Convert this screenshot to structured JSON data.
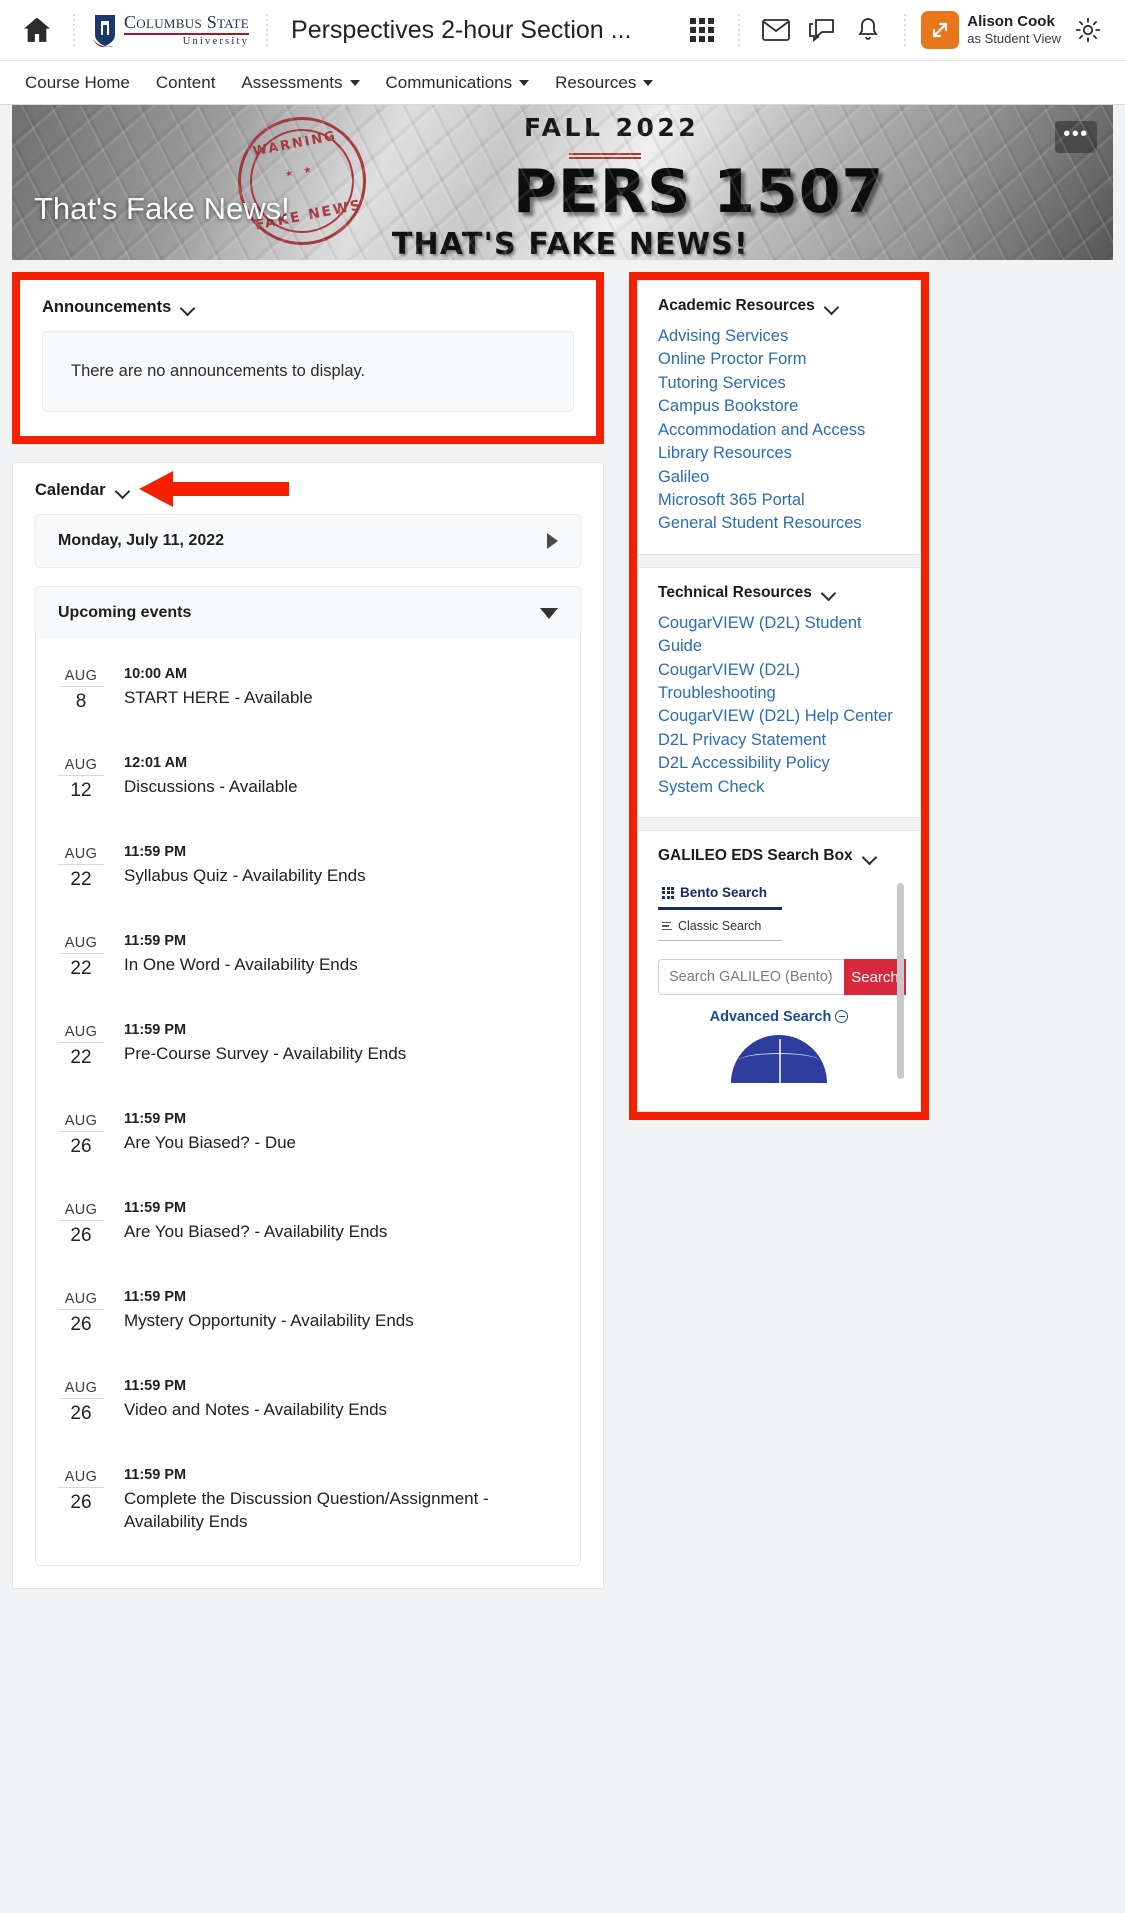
{
  "topbar": {
    "home_label": "Home",
    "logo": {
      "line1": "Columbus State",
      "rule": "",
      "line2": "University"
    },
    "course_title": "Perspectives 2-hour Section ...",
    "waffle_label": "Course Selector",
    "email_label": "Email",
    "messages_label": "Subscription Alerts",
    "notifications_label": "Update Alerts",
    "user": {
      "name": "Alison Cook",
      "role": "as Student View"
    },
    "settings_label": "Settings"
  },
  "coursenav": {
    "items": [
      {
        "label": "Course Home",
        "has_caret": false
      },
      {
        "label": "Content",
        "has_caret": false
      },
      {
        "label": "Assessments",
        "has_caret": true
      },
      {
        "label": "Communications",
        "has_caret": true
      },
      {
        "label": "Resources",
        "has_caret": true
      }
    ]
  },
  "banner": {
    "overlay_title": "That's Fake News!",
    "term": "FALL 2022",
    "course_code": "PERS 1507",
    "tagline": "THAT'S FAKE NEWS!",
    "stamp_top": "WARNING",
    "stamp_bottom": "FAKE NEWS",
    "stamp_stars": "★ ★",
    "more_label": "•••"
  },
  "announcements": {
    "title": "Announcements",
    "empty_message": "There are no announcements to display."
  },
  "calendar": {
    "title": "Calendar",
    "current_date": "Monday, July 11, 2022",
    "upcoming_label": "Upcoming events",
    "events": [
      {
        "month": "AUG",
        "day": "8",
        "time": "10:00 AM",
        "title": "START HERE - Available"
      },
      {
        "month": "AUG",
        "day": "12",
        "time": "12:01 AM",
        "title": "Discussions - Available"
      },
      {
        "month": "AUG",
        "day": "22",
        "time": "11:59 PM",
        "title": "Syllabus Quiz - Availability Ends"
      },
      {
        "month": "AUG",
        "day": "22",
        "time": "11:59 PM",
        "title": "In One Word - Availability Ends"
      },
      {
        "month": "AUG",
        "day": "22",
        "time": "11:59 PM",
        "title": "Pre-Course Survey - Availability Ends"
      },
      {
        "month": "AUG",
        "day": "26",
        "time": "11:59 PM",
        "title": "Are You Biased? - Due"
      },
      {
        "month": "AUG",
        "day": "26",
        "time": "11:59 PM",
        "title": "Are You Biased? - Availability Ends"
      },
      {
        "month": "AUG",
        "day": "26",
        "time": "11:59 PM",
        "title": "Mystery Opportunity - Availability Ends"
      },
      {
        "month": "AUG",
        "day": "26",
        "time": "11:59 PM",
        "title": "Video and Notes - Availability Ends"
      },
      {
        "month": "AUG",
        "day": "26",
        "time": "11:59 PM",
        "title": "Complete the Discussion Question/Assignment - Availability Ends"
      }
    ]
  },
  "academic_resources": {
    "title": "Academic Resources",
    "links": [
      "Advising Services",
      "Online Proctor Form",
      "Tutoring Services",
      "Campus Bookstore",
      "Accommodation and Access",
      "Library Resources",
      "Galileo",
      "Microsoft 365 Portal",
      "General Student Resources"
    ]
  },
  "technical_resources": {
    "title": "Technical Resources",
    "links": [
      "CougarVIEW (D2L) Student Guide",
      "CougarVIEW (D2L) Troubleshooting",
      "CougarVIEW (D2L) Help Center",
      "D2L Privacy Statement",
      "D2L Accessibility Policy",
      "System Check"
    ]
  },
  "galileo": {
    "title": "GALILEO EDS Search Box",
    "tab_bento": "Bento Search",
    "tab_classic": "Classic Search",
    "search_placeholder": "Search GALILEO (Bento)",
    "search_button": "Search",
    "advanced_search": "Advanced Search"
  },
  "annotations": {
    "highlight_color": "#f42000",
    "arrow_color": "#f42000"
  }
}
